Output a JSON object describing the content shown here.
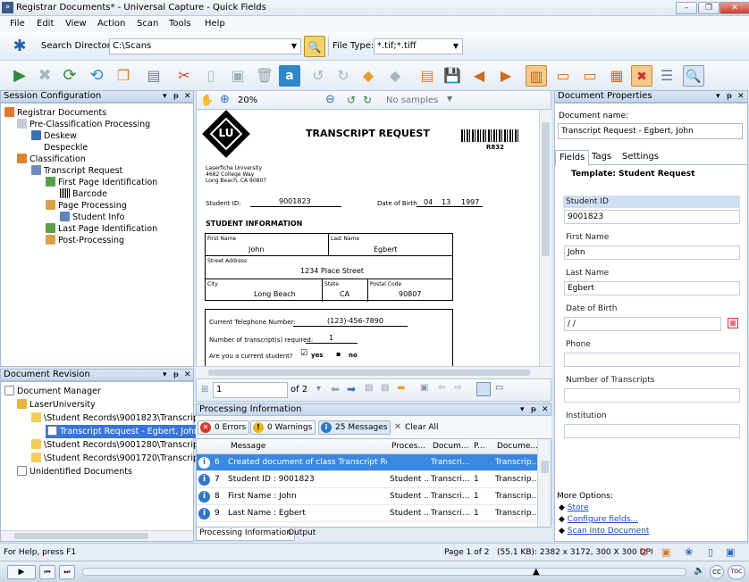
{
  "window": {
    "title": "Registrar Documents* - Universal Capture - Quick Fields"
  },
  "menu": [
    "File",
    "Edit",
    "View",
    "Action",
    "Scan",
    "Tools",
    "Help"
  ],
  "search": {
    "label": "Search Directory:",
    "value": "C:\\Scans",
    "filetype_label": "File Type:",
    "filetype_value": "*.tif;*.tiff"
  },
  "session": {
    "title": "Session Configuration",
    "items": [
      "Registrar Documents",
      "Pre-Classification Processing",
      "Deskew",
      "Despeckle",
      "Classification",
      "Transcript Request",
      "First Page Identification",
      "Barcode",
      "Page Processing",
      "Student Info",
      "Last Page Identification",
      "Post-Processing"
    ]
  },
  "revision": {
    "title": "Document Revision",
    "items": [
      "Document Manager",
      "LaserUniversity",
      "\\Student Records\\9001823\\Transcript R",
      "Transcript Request - Egbert, John",
      "\\Student Records\\9001280\\Transcript R",
      "\\Student Records\\9001720\\Transcript R",
      "Unidentified Documents"
    ]
  },
  "viewer": {
    "zoom": "20%",
    "samples": "No samples",
    "page": "1",
    "of_pages": "of 2"
  },
  "document": {
    "logo": "LU",
    "title": "TRANSCRIPT REQUEST",
    "barcode_text": "R832",
    "address": [
      "Laserfiche University",
      "4682 College Way",
      "Long Beach, CA 90807"
    ],
    "student_id_label": "Student ID:",
    "student_id": "9001823",
    "dob_label": "Date of Birth",
    "dob_m": "04",
    "dob_d": "13",
    "dob_y": "1997",
    "section": "STUDENT INFORMATION",
    "first_name_label": "First Name",
    "first_name": "John",
    "last_name_label": "Last Name",
    "last_name": "Egbert",
    "street_label": "Street Address",
    "street": "1234 Place Street",
    "city_label": "City",
    "city": "Long Beach",
    "state_label": "State",
    "state": "CA",
    "postal_label": "Postal Code",
    "postal": "90807",
    "phone_label": "Current Telephone Number:",
    "phone": "(123)-456-7890",
    "num_label": "Number of transcript(s) required:",
    "num": "1",
    "current_label": "Are you a current student?",
    "yes": "yes",
    "no": "no"
  },
  "processing": {
    "title": "Processing Information",
    "errors": "0 Errors",
    "warnings": "0 Warnings",
    "messages": "25 Messages",
    "clear": "Clear All",
    "columns": [
      "Message",
      "Proces...",
      "Docum...",
      "P...",
      "Docume..."
    ],
    "rows": [
      {
        "n": "6",
        "msg": "Created document of class Transcript Req...",
        "proc": "",
        "doc": "Transcri...",
        "p": "",
        "doc2": "Transcrip..."
      },
      {
        "n": "7",
        "msg": "Student ID : 9001823",
        "proc": "Student ...",
        "doc": "Transcri...",
        "p": "1",
        "doc2": "Transcrip..."
      },
      {
        "n": "8",
        "msg": "First Name : John",
        "proc": "Student ...",
        "doc": "Transcri...",
        "p": "1",
        "doc2": "Transcrip..."
      },
      {
        "n": "9",
        "msg": "Last Name : Egbert",
        "proc": "Student ...",
        "doc": "Transcri...",
        "p": "1",
        "doc2": "Transcrip..."
      }
    ],
    "tabs": [
      "Processing Information",
      "Output"
    ]
  },
  "properties": {
    "title": "Document Properties",
    "name_label": "Document name:",
    "name": "Transcript Request - Egbert, John",
    "tabs": [
      "Fields",
      "Tags",
      "Settings"
    ],
    "template": "Template: Student Request",
    "fields": [
      {
        "label": "Student ID",
        "value": "9001823"
      },
      {
        "label": "First Name",
        "value": "John"
      },
      {
        "label": "Last Name",
        "value": "Egbert"
      },
      {
        "label": "Date of Birth",
        "value": " / /"
      },
      {
        "label": "Phone",
        "value": ""
      },
      {
        "label": "Number of Transcripts",
        "value": ""
      },
      {
        "label": "Institution",
        "value": ""
      }
    ],
    "more": "More Options:",
    "links": [
      "Store",
      "Configure fields...",
      "Scan Into Document"
    ]
  },
  "status": {
    "help": "For Help, press F1",
    "page": "Page 1 of 2",
    "info": "(55.1 KB): 2382 x 3172, 300 X 300 DPI"
  }
}
